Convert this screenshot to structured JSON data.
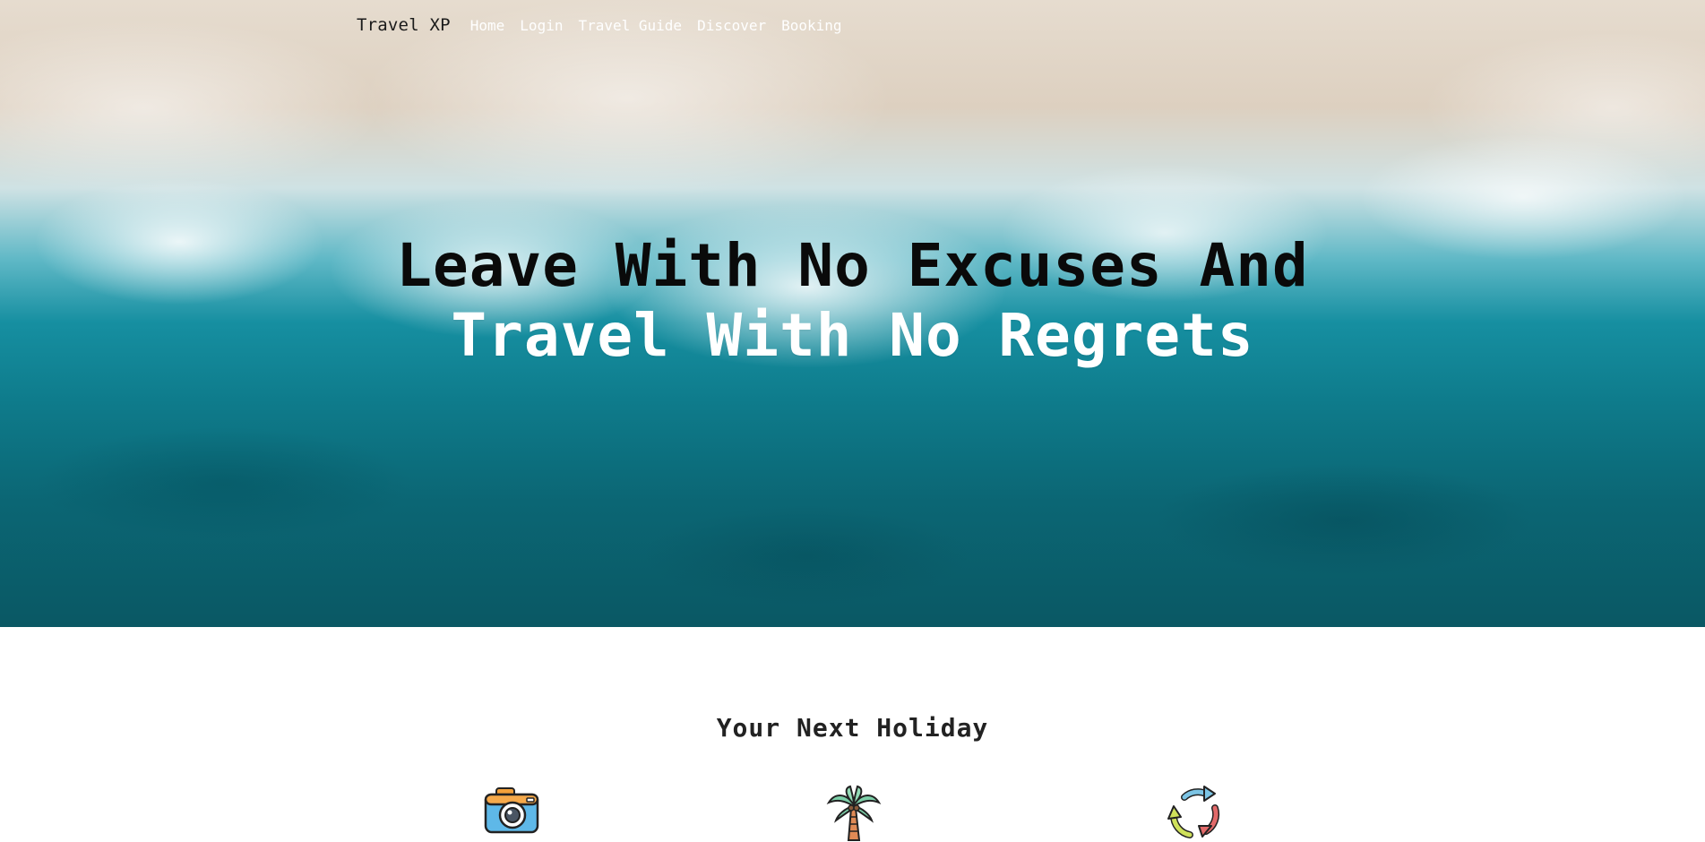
{
  "nav": {
    "brand": "Travel XP",
    "links": [
      {
        "label": "Home"
      },
      {
        "label": "Login"
      },
      {
        "label": "Travel Guide"
      },
      {
        "label": "Discover"
      },
      {
        "label": "Booking"
      }
    ]
  },
  "hero": {
    "headline_line1": "Leave With No Excuses And",
    "headline_line2": "Travel With No Regrets"
  },
  "section": {
    "title": "Your Next Holiday",
    "icons": [
      "camera-icon",
      "palm-tree-icon",
      "refresh-arrows-icon"
    ]
  },
  "colors": {
    "nav_link": "#ffffff",
    "brand": "#1b1b1b",
    "headline_dark": "#0a0a0a",
    "headline_light": "#ffffff",
    "water": "#0e7b8b"
  }
}
